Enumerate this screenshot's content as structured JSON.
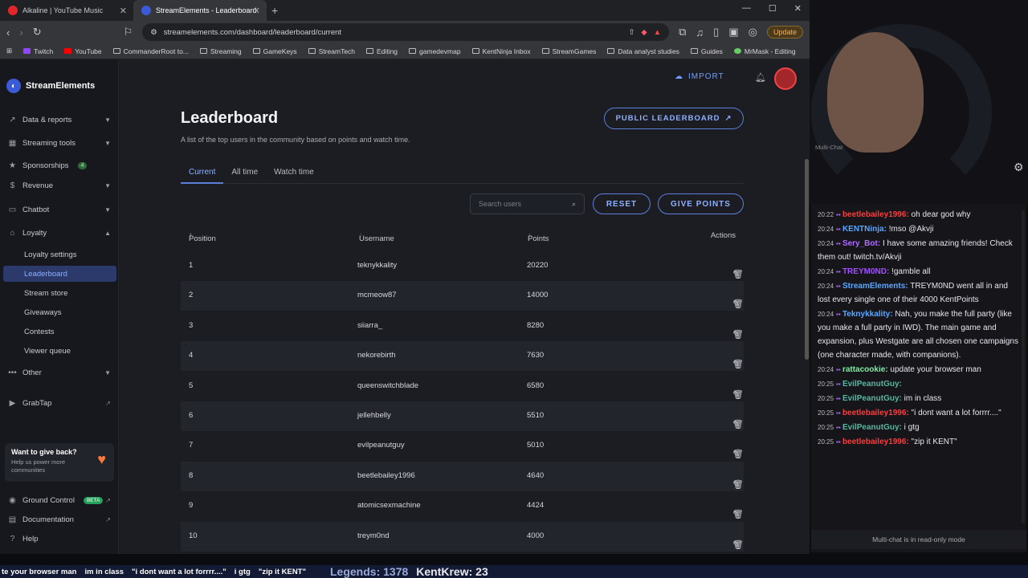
{
  "browser": {
    "tabs": [
      {
        "label": "Alkaline | YouTube Music"
      },
      {
        "label": "StreamElements - Leaderboard"
      }
    ],
    "url": "streamelements.com/dashboard/leaderboard/current",
    "update_label": "Update",
    "bookmarks": [
      "Twitch",
      "YouTube",
      "CommanderRoot to...",
      "Streaming",
      "GameKeys",
      "StreamTech",
      "Editing",
      "gamedevmap",
      "KentNinja Inbox",
      "StreamGames",
      "Data analyst studies",
      "Guides",
      "MrMask - Editing"
    ]
  },
  "app": {
    "brand": "StreamElements",
    "import_label": "IMPORT",
    "sidebar": {
      "data_reports": "Data & reports",
      "streaming_tools": "Streaming tools",
      "sponsorships": "Sponsorships",
      "sponsorships_badge": "4",
      "revenue": "Revenue",
      "chatbot": "Chatbot",
      "loyalty": "Loyalty",
      "loyalty_settings": "Loyalty settings",
      "leaderboard": "Leaderboard",
      "stream_store": "Stream store",
      "giveaways": "Giveaways",
      "contests": "Contests",
      "viewer_queue": "Viewer queue",
      "other": "Other",
      "grabtap": "GrabTap",
      "give_title": "Want to give back?",
      "give_text": "Help us power more communities",
      "ground_control": "Ground Control",
      "beta": "BETA",
      "documentation": "Documentation",
      "help": "Help"
    },
    "page": {
      "title": "Leaderboard",
      "description": "A list of the top users in the community based on points and watch time.",
      "public_btn": "PUBLIC LEADERBOARD",
      "tabs": [
        "Current",
        "All time",
        "Watch time"
      ],
      "search_placeholder": "Search users",
      "reset_btn": "RESET",
      "give_points_btn": "GIVE POINTS",
      "columns": {
        "position": "Position",
        "username": "Username",
        "points": "Points",
        "actions": "Actions"
      },
      "rows": [
        {
          "pos": "1",
          "user": "teknykkality",
          "points": "20220"
        },
        {
          "pos": "2",
          "user": "mcmeow87",
          "points": "14000"
        },
        {
          "pos": "3",
          "user": "siiarra_",
          "points": "8280"
        },
        {
          "pos": "4",
          "user": "nekorebirth",
          "points": "7630"
        },
        {
          "pos": "5",
          "user": "queenswitchblade",
          "points": "6580"
        },
        {
          "pos": "6",
          "user": "jellehbelly",
          "points": "5510"
        },
        {
          "pos": "7",
          "user": "evilpeanutguy",
          "points": "5010"
        },
        {
          "pos": "8",
          "user": "beetlebailey1996",
          "points": "4640"
        },
        {
          "pos": "9",
          "user": "atomicsexmachine",
          "points": "4424"
        },
        {
          "pos": "10",
          "user": "treym0nd",
          "points": "4000"
        }
      ]
    }
  },
  "chat": {
    "label": "Multi-Chat",
    "readonly": "Multi-chat is in read-only mode",
    "messages": [
      {
        "time": "20:22",
        "user": "beetlebailey1996",
        "color": "#ff3b3b",
        "text": "oh dear god why"
      },
      {
        "time": "20:24",
        "user": "KENTNinja",
        "color": "#5aa7ff",
        "text": "!mso @Akvji"
      },
      {
        "time": "20:24",
        "user": "Sery_Bot",
        "color": "#b06cff",
        "text": "I have some amazing friends! Check them out! twitch.tv/Akvji"
      },
      {
        "time": "20:24",
        "user": "TREYM0ND",
        "color": "#a050ff",
        "text": "!gamble all"
      },
      {
        "time": "20:24",
        "user": "StreamElements",
        "color": "#5aa7ff",
        "text": "TREYM0ND went all in and lost every single one of their 4000 KentPoints"
      },
      {
        "time": "20:24",
        "user": "Teknykkality",
        "color": "#5aa7ff",
        "text": "Nah, you make the full party (like you make a full party in IWD). The main game and expansion, plus Westgate are all chosen one campaigns (one character made, with companions)."
      },
      {
        "time": "20:24",
        "user": "rattacookie",
        "color": "#7cf0a0",
        "text": "update your browser man"
      },
      {
        "time": "20:25",
        "user": "EvilPeanutGuy",
        "color": "#58b7a0",
        "text": ""
      },
      {
        "time": "20:25",
        "user": "EvilPeanutGuy",
        "color": "#58b7a0",
        "text": "im in class"
      },
      {
        "time": "20:25",
        "user": "beetlebailey1996",
        "color": "#ff3b3b",
        "text": "\"i dont want a lot forrrr....\""
      },
      {
        "time": "20:25",
        "user": "EvilPeanutGuy",
        "color": "#58b7a0",
        "text": "i gtg"
      },
      {
        "time": "20:25",
        "user": "beetlebailey1996",
        "color": "#ff3b3b",
        "text": "\"zip it KENT\""
      }
    ]
  },
  "ticker": {
    "items": [
      "te your browser man",
      "im in class",
      "\"i dont want a lot forrrr....\"",
      "i gtg",
      "\"zip it KENT\""
    ],
    "legends": "Legends: 1378",
    "kentkrew": "KentKrew: 23"
  }
}
